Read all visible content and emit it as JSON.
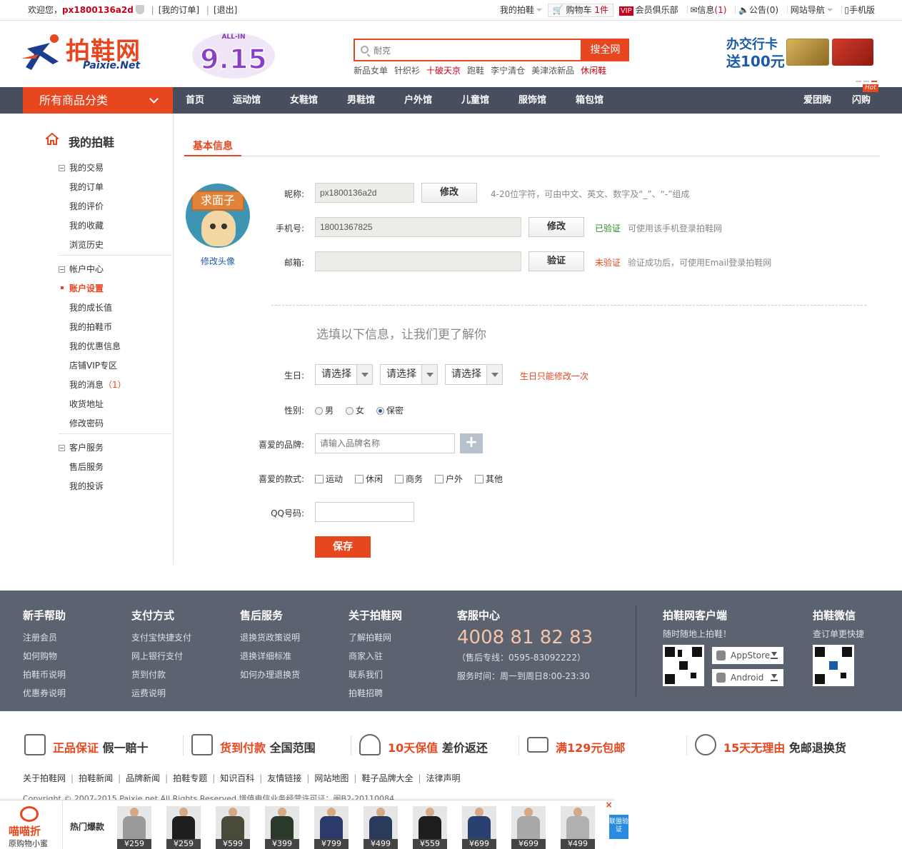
{
  "topbar": {
    "welcome": "欢迎您，",
    "username": "px1800136a2d",
    "my_orders": "[我的订单]",
    "logout": "[退出]",
    "my_paixie": "我的拍鞋",
    "cart_label": "购物车",
    "cart_count": "1件",
    "vip_badge": "VIP",
    "vip_club": "会员俱乐部",
    "messages": "信息",
    "messages_count": "(1)",
    "notice": "公告",
    "notice_count": "(0)",
    "site_nav": "网站导航",
    "mobile": "手机版"
  },
  "header": {
    "logo_text": "拍鞋网",
    "logo_sub": "Paixie.Net",
    "promo_text": "9.15",
    "promo_sub": "ALL-IN",
    "search_placeholder": "耐克",
    "search_button": "搜全网",
    "hotwords": [
      "新品女单",
      "针织衫",
      "十破天京",
      "跑鞋",
      "李宁清仓",
      "美津浓新品",
      "休闲鞋"
    ],
    "hotwords_highlight": [
      2,
      6
    ],
    "ad_line1": "办交行卡",
    "ad_line2": "送100元"
  },
  "nav": {
    "category": "所有商品分类",
    "items": [
      "首页",
      "运动馆",
      "女鞋馆",
      "男鞋馆",
      "户外馆",
      "儿童馆",
      "服饰馆",
      "箱包馆"
    ],
    "right_items": [
      "爱团购",
      "闪购"
    ],
    "hot_badge": "Hot"
  },
  "sidebar": {
    "title": "我的拍鞋",
    "groups": [
      {
        "label": "我的交易",
        "links": [
          "我的订单",
          "我的评价",
          "我的收藏",
          "浏览历史"
        ]
      },
      {
        "label": "帐户中心",
        "links": [
          "账户设置",
          "我的成长值",
          "我的拍鞋币",
          "我的优惠信息",
          "店铺VIP专区",
          "我的消息",
          "收货地址",
          "修改密码"
        ]
      },
      {
        "label": "客户服务",
        "links": [
          "售后服务",
          "我的投诉"
        ]
      }
    ],
    "messages_count": "（1）"
  },
  "main": {
    "tab": "基本信息",
    "avatar_sign": "求面子",
    "change_avatar": "修改头像",
    "nickname_label": "昵称:",
    "nickname_value": "px1800136a2d",
    "nickname_button": "修改",
    "nickname_hint": "4-20位字符，可由中文、英文、数字及“_”、“-”组成",
    "phone_label": "手机号:",
    "phone_value": "18001367825",
    "phone_button": "修改",
    "phone_status": "已验证",
    "phone_hint": "可使用该手机登录拍鞋网",
    "email_label": "邮箱:",
    "email_value": "",
    "email_button": "验证",
    "email_status": "未验证",
    "email_hint": "验证成功后，可使用Email登录拍鞋网",
    "optional_title": "选填以下信息，让我们更了解你",
    "birthday_label": "生日:",
    "birthday_selects": [
      "请选择",
      "请选择",
      "请选择"
    ],
    "birthday_hint": "生日只能修改一次",
    "gender_label": "性别:",
    "gender_options": [
      "男",
      "女",
      "保密"
    ],
    "gender_selected": "保密",
    "brand_label": "喜爱的品牌:",
    "brand_placeholder": "请输入品牌名称",
    "brand_add": "+",
    "style_label": "喜爱的款式:",
    "style_options": [
      "运动",
      "休闲",
      "商务",
      "户外",
      "其他"
    ],
    "qq_label": "QQ号码:",
    "qq_value": "",
    "save_button": "保存"
  },
  "footer": {
    "cols": [
      {
        "title": "新手帮助",
        "links": [
          "注册会员",
          "如何购物",
          "拍鞋币说明",
          "优惠券说明"
        ]
      },
      {
        "title": "支付方式",
        "links": [
          "支付宝快捷支付",
          "网上银行支付",
          "货到付款",
          "运费说明"
        ]
      },
      {
        "title": "售后服务",
        "links": [
          "退换货政策说明",
          "退换详细标准",
          "如何办理退换货"
        ]
      },
      {
        "title": "关于拍鞋网",
        "links": [
          "了解拍鞋网",
          "商家入驻",
          "联系我们",
          "拍鞋招聘"
        ]
      }
    ],
    "service_title": "客服中心",
    "service_phone": "4008 81 82 83",
    "service_after": "（售后专线：0595-83092222）",
    "service_hours": "服务时间：周一到周日8:00-23:30",
    "client_title": "拍鞋网客户端",
    "client_sub": "随时随地上拍鞋！",
    "appstore": "AppStore",
    "android": "Android",
    "wechat_title": "拍鞋微信",
    "wechat_sub": "查订单更快捷"
  },
  "guarantees": [
    {
      "a": "正品保证",
      "b": "假一赔十"
    },
    {
      "a": "货到付款",
      "b": "全国范围"
    },
    {
      "a": "10天保值",
      "b": "差价返还"
    },
    {
      "a": "满129元包邮",
      "b": ""
    },
    {
      "a": "15天无理由",
      "b": "免邮退换货"
    }
  ],
  "footer_links": [
    "关于拍鞋网",
    "拍鞋新闻",
    "品牌新闻",
    "拍鞋专题",
    "知识百科",
    "友情链接",
    "网站地图",
    "鞋子品牌大全",
    "法律声明"
  ],
  "copyright": "Copyright © 2007-2015 Paixie.net All Rights Reserved 增值电信业务经营许可证：闽B2-20110084",
  "adstrip": {
    "brand_name": "喵喵折",
    "brand_sub": "原购物小蜜",
    "hot_label": "热门爆款",
    "close": "×",
    "verify": "联盟验证",
    "prices": [
      "¥259",
      "¥259",
      "¥599",
      "¥399",
      "¥799",
      "¥499",
      "¥559",
      "¥699",
      "¥699",
      "¥499"
    ],
    "product_colors": [
      "#9a9a9a",
      "#1e1e1e",
      "#4a4a3a",
      "#2a3a2a",
      "#2a3a6a",
      "#2a3a5a",
      "#1e1e1e",
      "#2a4070",
      "#a8a8a8",
      "#b0b0b0"
    ]
  },
  "colors": {
    "accent": "#e8461e",
    "nav_bg": "#474f5f",
    "footer_bg": "#5c6370",
    "link_blue": "#1b5aa6"
  }
}
